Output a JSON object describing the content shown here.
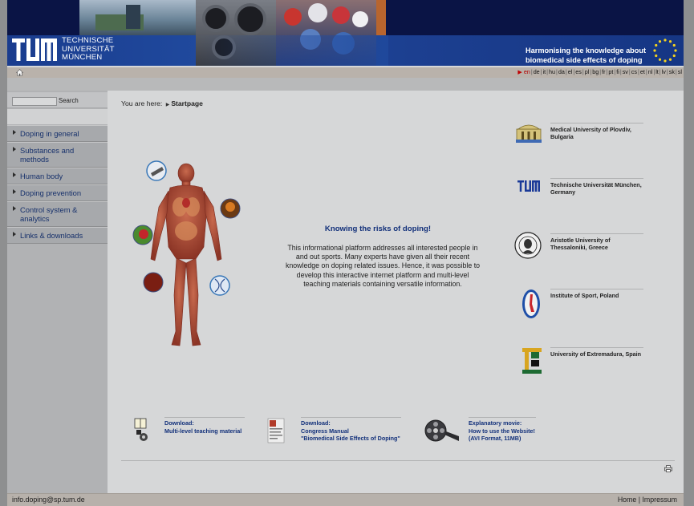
{
  "header": {
    "university_name": [
      "TECHNISCHE",
      "UNIVERSITÄT",
      "MÜNCHEN"
    ],
    "tagline": [
      "Harmonising the knowledge about",
      "biomedical side effects of doping"
    ]
  },
  "langbar": {
    "languages": [
      "en",
      "de",
      "it",
      "hu",
      "da",
      "el",
      "es",
      "pl",
      "bg",
      "fr",
      "pt",
      "fi",
      "sv",
      "cs",
      "et",
      "nl",
      "lt",
      "lv",
      "sk",
      "sl"
    ],
    "active": "en",
    "colors": {
      "active": "#b00000"
    }
  },
  "sidebar": {
    "search_label": "Search",
    "search_value": "",
    "items": [
      {
        "label": "Doping in general"
      },
      {
        "label": "Substances and methods"
      },
      {
        "label": "Human body"
      },
      {
        "label": "Doping prevention"
      },
      {
        "label": "Control system & analytics"
      },
      {
        "label": "Links & downloads"
      }
    ]
  },
  "main": {
    "breadcrumb_prefix": "You are here:",
    "breadcrumb_current": "Startpage",
    "intro_title": "Knowing the risks of doping!",
    "intro_text": "This informational platform addresses all interested people in and out sports. Many experts have given all their recent knowledge on doping related issues. Hence, it was possible to develop this interactive internet platform and multi-level teaching materials containing versatile information.",
    "partners": [
      {
        "name_l1": "Medical University of Plovdiv,",
        "name_l2": "Bulgaria",
        "icon": "plovdiv-seal-icon"
      },
      {
        "name_l1": "Technische Universität München,",
        "name_l2": "Germany",
        "icon": "tum-logo-icon"
      },
      {
        "name_l1": "Aristotle University of",
        "name_l2": "Thessaloniki, Greece",
        "icon": "aristotle-seal-icon"
      },
      {
        "name_l1": "Institute of Sport, Poland",
        "name_l2": "",
        "icon": "institute-sport-icon"
      },
      {
        "name_l1": "University of Extremadura, Spain",
        "name_l2": "",
        "icon": "extremadura-logo-icon"
      }
    ],
    "downloads": [
      {
        "title": "Download:",
        "line1": "Multi-level teaching material",
        "line2": "",
        "icon": "teaching-material-icon"
      },
      {
        "title": "Download:",
        "line1": "Congress Manual",
        "line2": "\"Biomedical Side Effects of Doping\"",
        "icon": "manual-document-icon"
      },
      {
        "title": "Explanatory movie:",
        "line1": "How to use the Website!",
        "line2": "(AVI Format, 11MB)",
        "icon": "film-reel-icon"
      }
    ]
  },
  "footer": {
    "email": "info.doping@sp.tum.de",
    "home": "Home",
    "separator": "|",
    "impressum": "Impressum"
  },
  "colors": {
    "header_navy": "#0a1445",
    "header_blue": "#204a9e",
    "link_blue": "#12307a",
    "sidebar_text": "#16306b"
  }
}
